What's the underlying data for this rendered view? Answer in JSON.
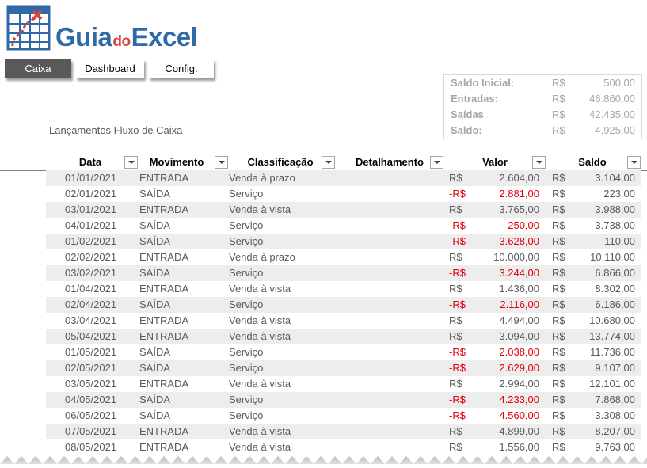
{
  "logo": {
    "part1": "Guia",
    "part2": "do",
    "part3": "Excel"
  },
  "nav": {
    "caixa": "Caixa",
    "dashboard": "Dashboard",
    "config": "Config."
  },
  "summary": [
    {
      "label": "Saldo Inicial:",
      "currency": "R$",
      "value": "500,00"
    },
    {
      "label": "Entradas:",
      "currency": "R$",
      "value": "46.860,00"
    },
    {
      "label": "Saídas",
      "currency": "R$",
      "value": "42.435,00"
    },
    {
      "label": "Saldo:",
      "currency": "R$",
      "value": "4.925,00"
    }
  ],
  "section_title": "Lançamentos Fluxo de Caixa",
  "columns": [
    "Data",
    "Movimento",
    "Classificação",
    "Detalhamento",
    "Valor",
    "Saldo"
  ],
  "rows": [
    {
      "date": "01/01/2021",
      "mov": "ENTRADA",
      "cls": "Venda à prazo",
      "cur": "R$",
      "val": "2.604,00",
      "neg": false,
      "scur": "R$",
      "sal": "3.104,00"
    },
    {
      "date": "02/01/2021",
      "mov": "SAÍDA",
      "cls": "Serviço",
      "cur": "-R$",
      "val": "2.881,00",
      "neg": true,
      "scur": "R$",
      "sal": "223,00"
    },
    {
      "date": "03/01/2021",
      "mov": "ENTRADA",
      "cls": "Venda à vista",
      "cur": "R$",
      "val": "3.765,00",
      "neg": false,
      "scur": "R$",
      "sal": "3.988,00"
    },
    {
      "date": "04/01/2021",
      "mov": "SAÍDA",
      "cls": "Serviço",
      "cur": "-R$",
      "val": "250,00",
      "neg": true,
      "scur": "R$",
      "sal": "3.738,00"
    },
    {
      "date": "01/02/2021",
      "mov": "SAÍDA",
      "cls": "Serviço",
      "cur": "-R$",
      "val": "3.628,00",
      "neg": true,
      "scur": "R$",
      "sal": "110,00"
    },
    {
      "date": "02/02/2021",
      "mov": "ENTRADA",
      "cls": "Venda à prazo",
      "cur": "R$",
      "val": "10.000,00",
      "neg": false,
      "scur": "R$",
      "sal": "10.110,00"
    },
    {
      "date": "03/02/2021",
      "mov": "SAÍDA",
      "cls": "Serviço",
      "cur": "-R$",
      "val": "3.244,00",
      "neg": true,
      "scur": "R$",
      "sal": "6.866,00"
    },
    {
      "date": "01/04/2021",
      "mov": "ENTRADA",
      "cls": "Venda à vista",
      "cur": "R$",
      "val": "1.436,00",
      "neg": false,
      "scur": "R$",
      "sal": "8.302,00"
    },
    {
      "date": "02/04/2021",
      "mov": "SAÍDA",
      "cls": "Serviço",
      "cur": "-R$",
      "val": "2.116,00",
      "neg": true,
      "scur": "R$",
      "sal": "6.186,00"
    },
    {
      "date": "03/04/2021",
      "mov": "ENTRADA",
      "cls": "Venda à vista",
      "cur": "R$",
      "val": "4.494,00",
      "neg": false,
      "scur": "R$",
      "sal": "10.680,00"
    },
    {
      "date": "05/04/2021",
      "mov": "ENTRADA",
      "cls": "Venda à vista",
      "cur": "R$",
      "val": "3.094,00",
      "neg": false,
      "scur": "R$",
      "sal": "13.774,00"
    },
    {
      "date": "01/05/2021",
      "mov": "SAÍDA",
      "cls": "Serviço",
      "cur": "-R$",
      "val": "2.038,00",
      "neg": true,
      "scur": "R$",
      "sal": "11.736,00"
    },
    {
      "date": "02/05/2021",
      "mov": "SAÍDA",
      "cls": "Serviço",
      "cur": "-R$",
      "val": "2.629,00",
      "neg": true,
      "scur": "R$",
      "sal": "9.107,00"
    },
    {
      "date": "03/05/2021",
      "mov": "ENTRADA",
      "cls": "Venda à vista",
      "cur": "R$",
      "val": "2.994,00",
      "neg": false,
      "scur": "R$",
      "sal": "12.101,00"
    },
    {
      "date": "04/05/2021",
      "mov": "SAÍDA",
      "cls": "Serviço",
      "cur": "-R$",
      "val": "4.233,00",
      "neg": true,
      "scur": "R$",
      "sal": "7.868,00"
    },
    {
      "date": "06/05/2021",
      "mov": "SAÍDA",
      "cls": "Serviço",
      "cur": "-R$",
      "val": "4.560,00",
      "neg": true,
      "scur": "R$",
      "sal": "3.308,00"
    },
    {
      "date": "07/05/2021",
      "mov": "ENTRADA",
      "cls": "Venda à vista",
      "cur": "R$",
      "val": "4.899,00",
      "neg": false,
      "scur": "R$",
      "sal": "8.207,00"
    },
    {
      "date": "08/05/2021",
      "mov": "ENTRADA",
      "cls": "Venda à vista",
      "cur": "R$",
      "val": "1.556,00",
      "neg": false,
      "scur": "R$",
      "sal": "9.763,00"
    }
  ],
  "colors": {
    "brand_blue": "#2e6aa6",
    "brand_red": "#d64541",
    "negative": "#e0000b",
    "row_alt": "#ededed",
    "active_tab": "#595959"
  }
}
